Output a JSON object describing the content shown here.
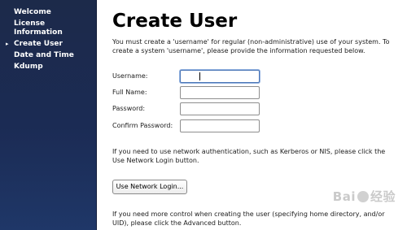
{
  "sidebar": {
    "current_marker": "▸",
    "items": [
      {
        "label": "Welcome"
      },
      {
        "label": "License Information"
      },
      {
        "label": "Create User",
        "current": true
      },
      {
        "label": "Date and Time"
      },
      {
        "label": "Kdump"
      }
    ]
  },
  "page": {
    "title": "Create User",
    "intro": "You must create a 'username' for regular (non-administrative) use of your system.  To create a system 'username', please provide the information requested below."
  },
  "form": {
    "username": {
      "label": "Username:",
      "value": ""
    },
    "full_name": {
      "label": "Full Name:",
      "value": ""
    },
    "password": {
      "label": "Password:",
      "value": ""
    },
    "confirm_password": {
      "label": "Confirm Password:",
      "value": ""
    }
  },
  "network": {
    "text": "If you need to use network authentication, such as Kerberos or NIS, please click the Use Network Login button.",
    "button_label": "Use Network Login..."
  },
  "advanced": {
    "text": "If you need more control when creating the user (specifying home directory, and/or UID), please click the Advanced button."
  },
  "watermark": {
    "left": "Bai",
    "right": "经验"
  }
}
